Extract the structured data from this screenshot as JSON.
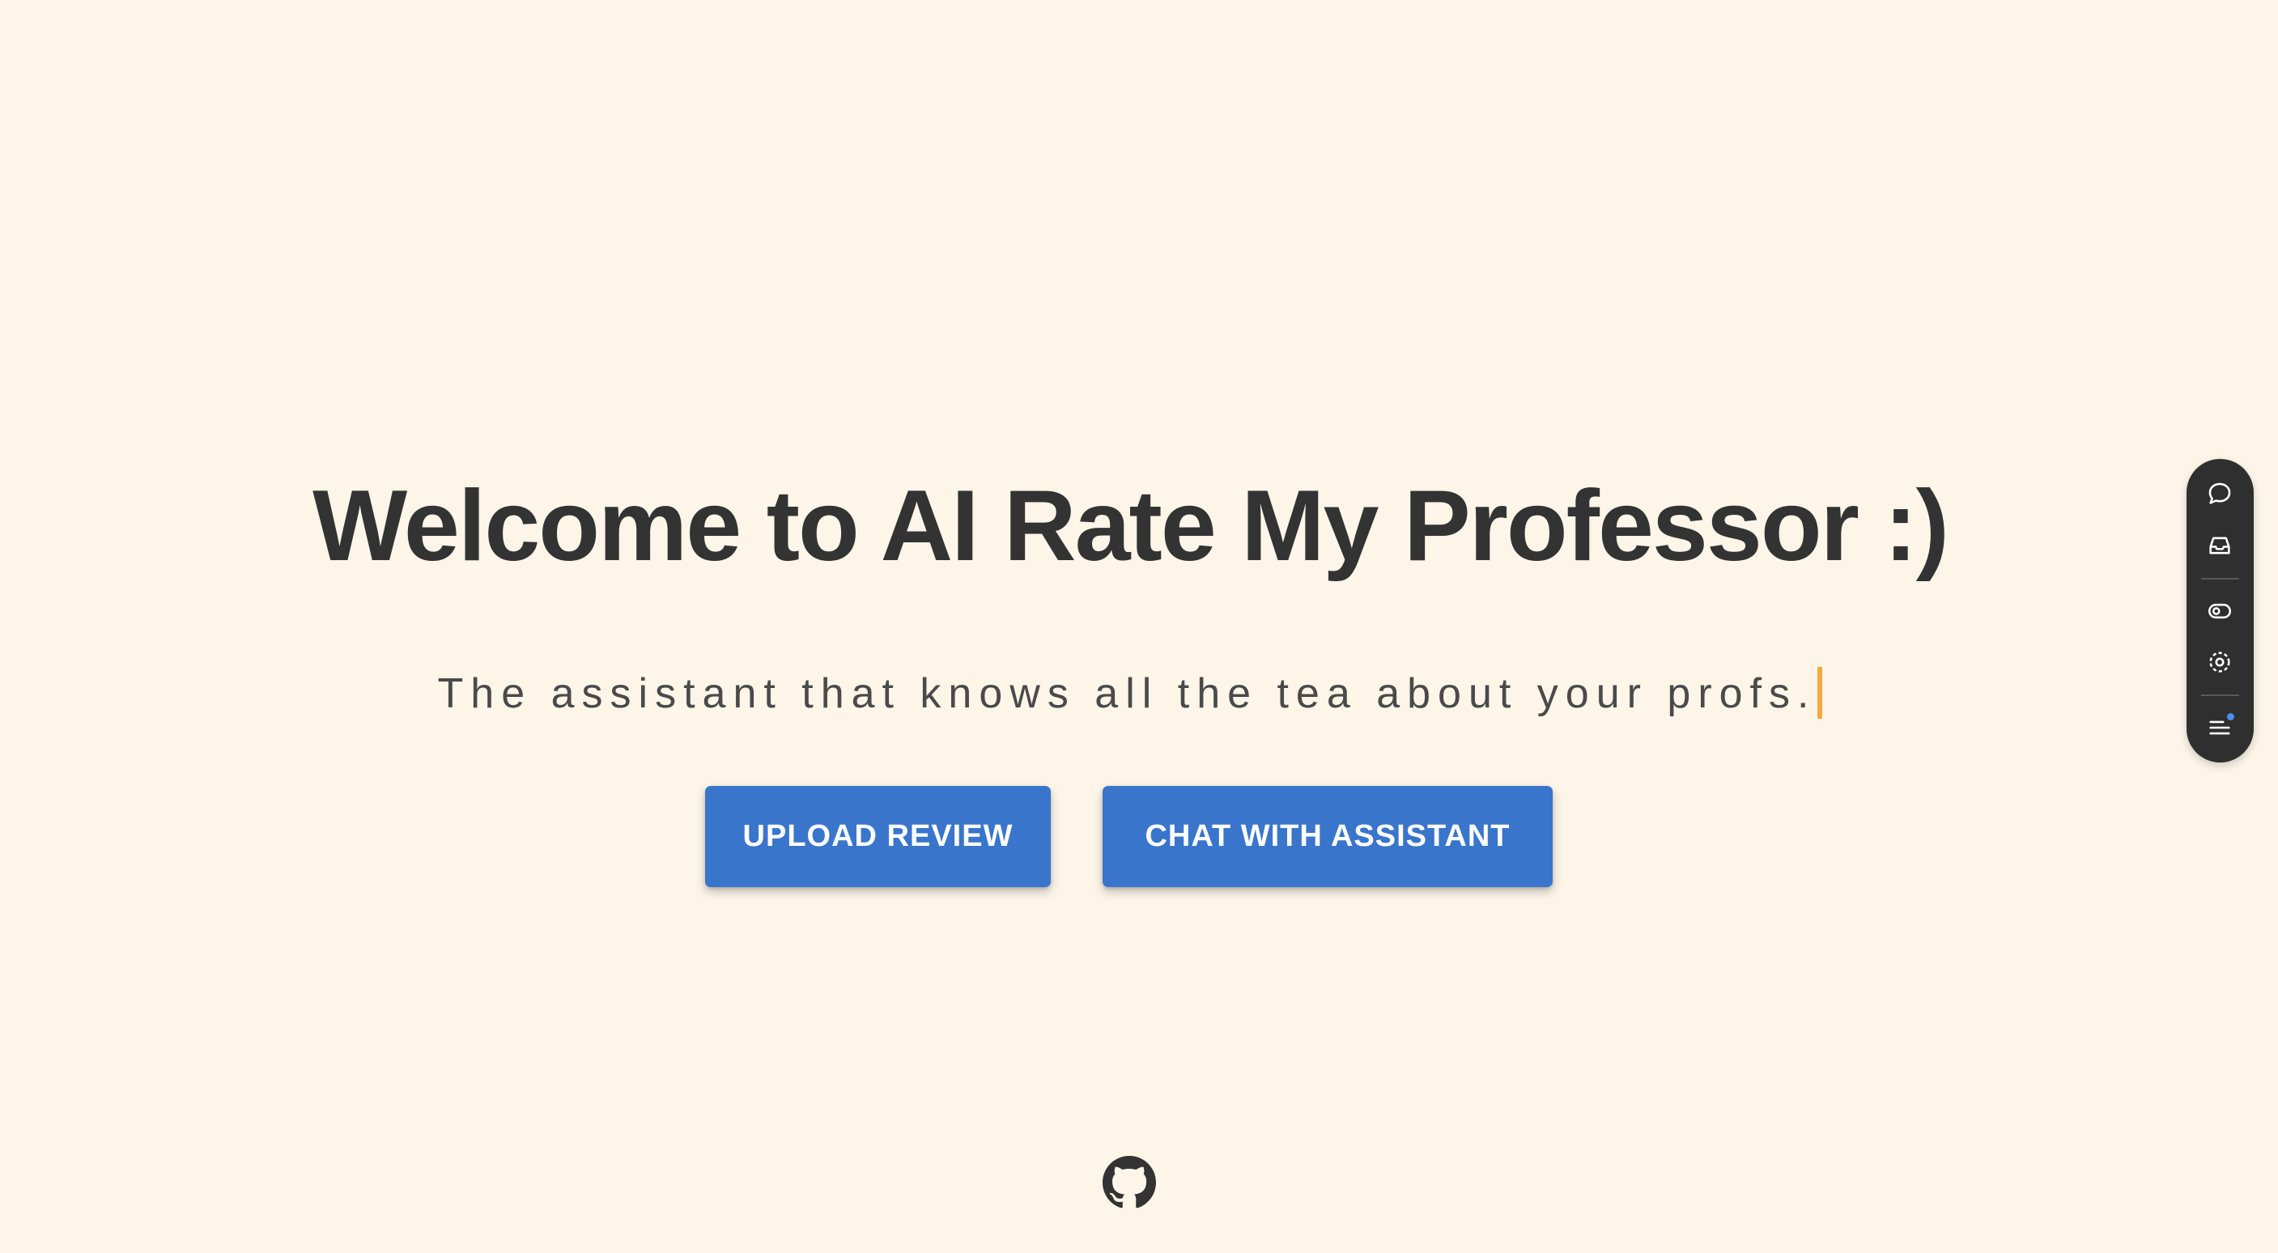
{
  "hero": {
    "title": "Welcome to AI Rate My Professor :)",
    "subtitle": "The assistant that knows all the tea about your profs."
  },
  "actions": {
    "upload_label": "UPLOAD REVIEW",
    "chat_label": "CHAT WITH ASSISTANT"
  },
  "footer": {
    "icon": "github-icon"
  },
  "side_dock": {
    "icons": [
      "chat-bubble-icon",
      "inbox-tray-icon",
      "toggle-icon",
      "focus-target-icon",
      "menu-icon"
    ]
  },
  "colors": {
    "background": "#fcf5e8",
    "button": "#3a75cc",
    "title_text": "#333333",
    "caret": "#f2a93b",
    "dock": "#2f2f2f",
    "notification_dot": "#4a8df0"
  }
}
